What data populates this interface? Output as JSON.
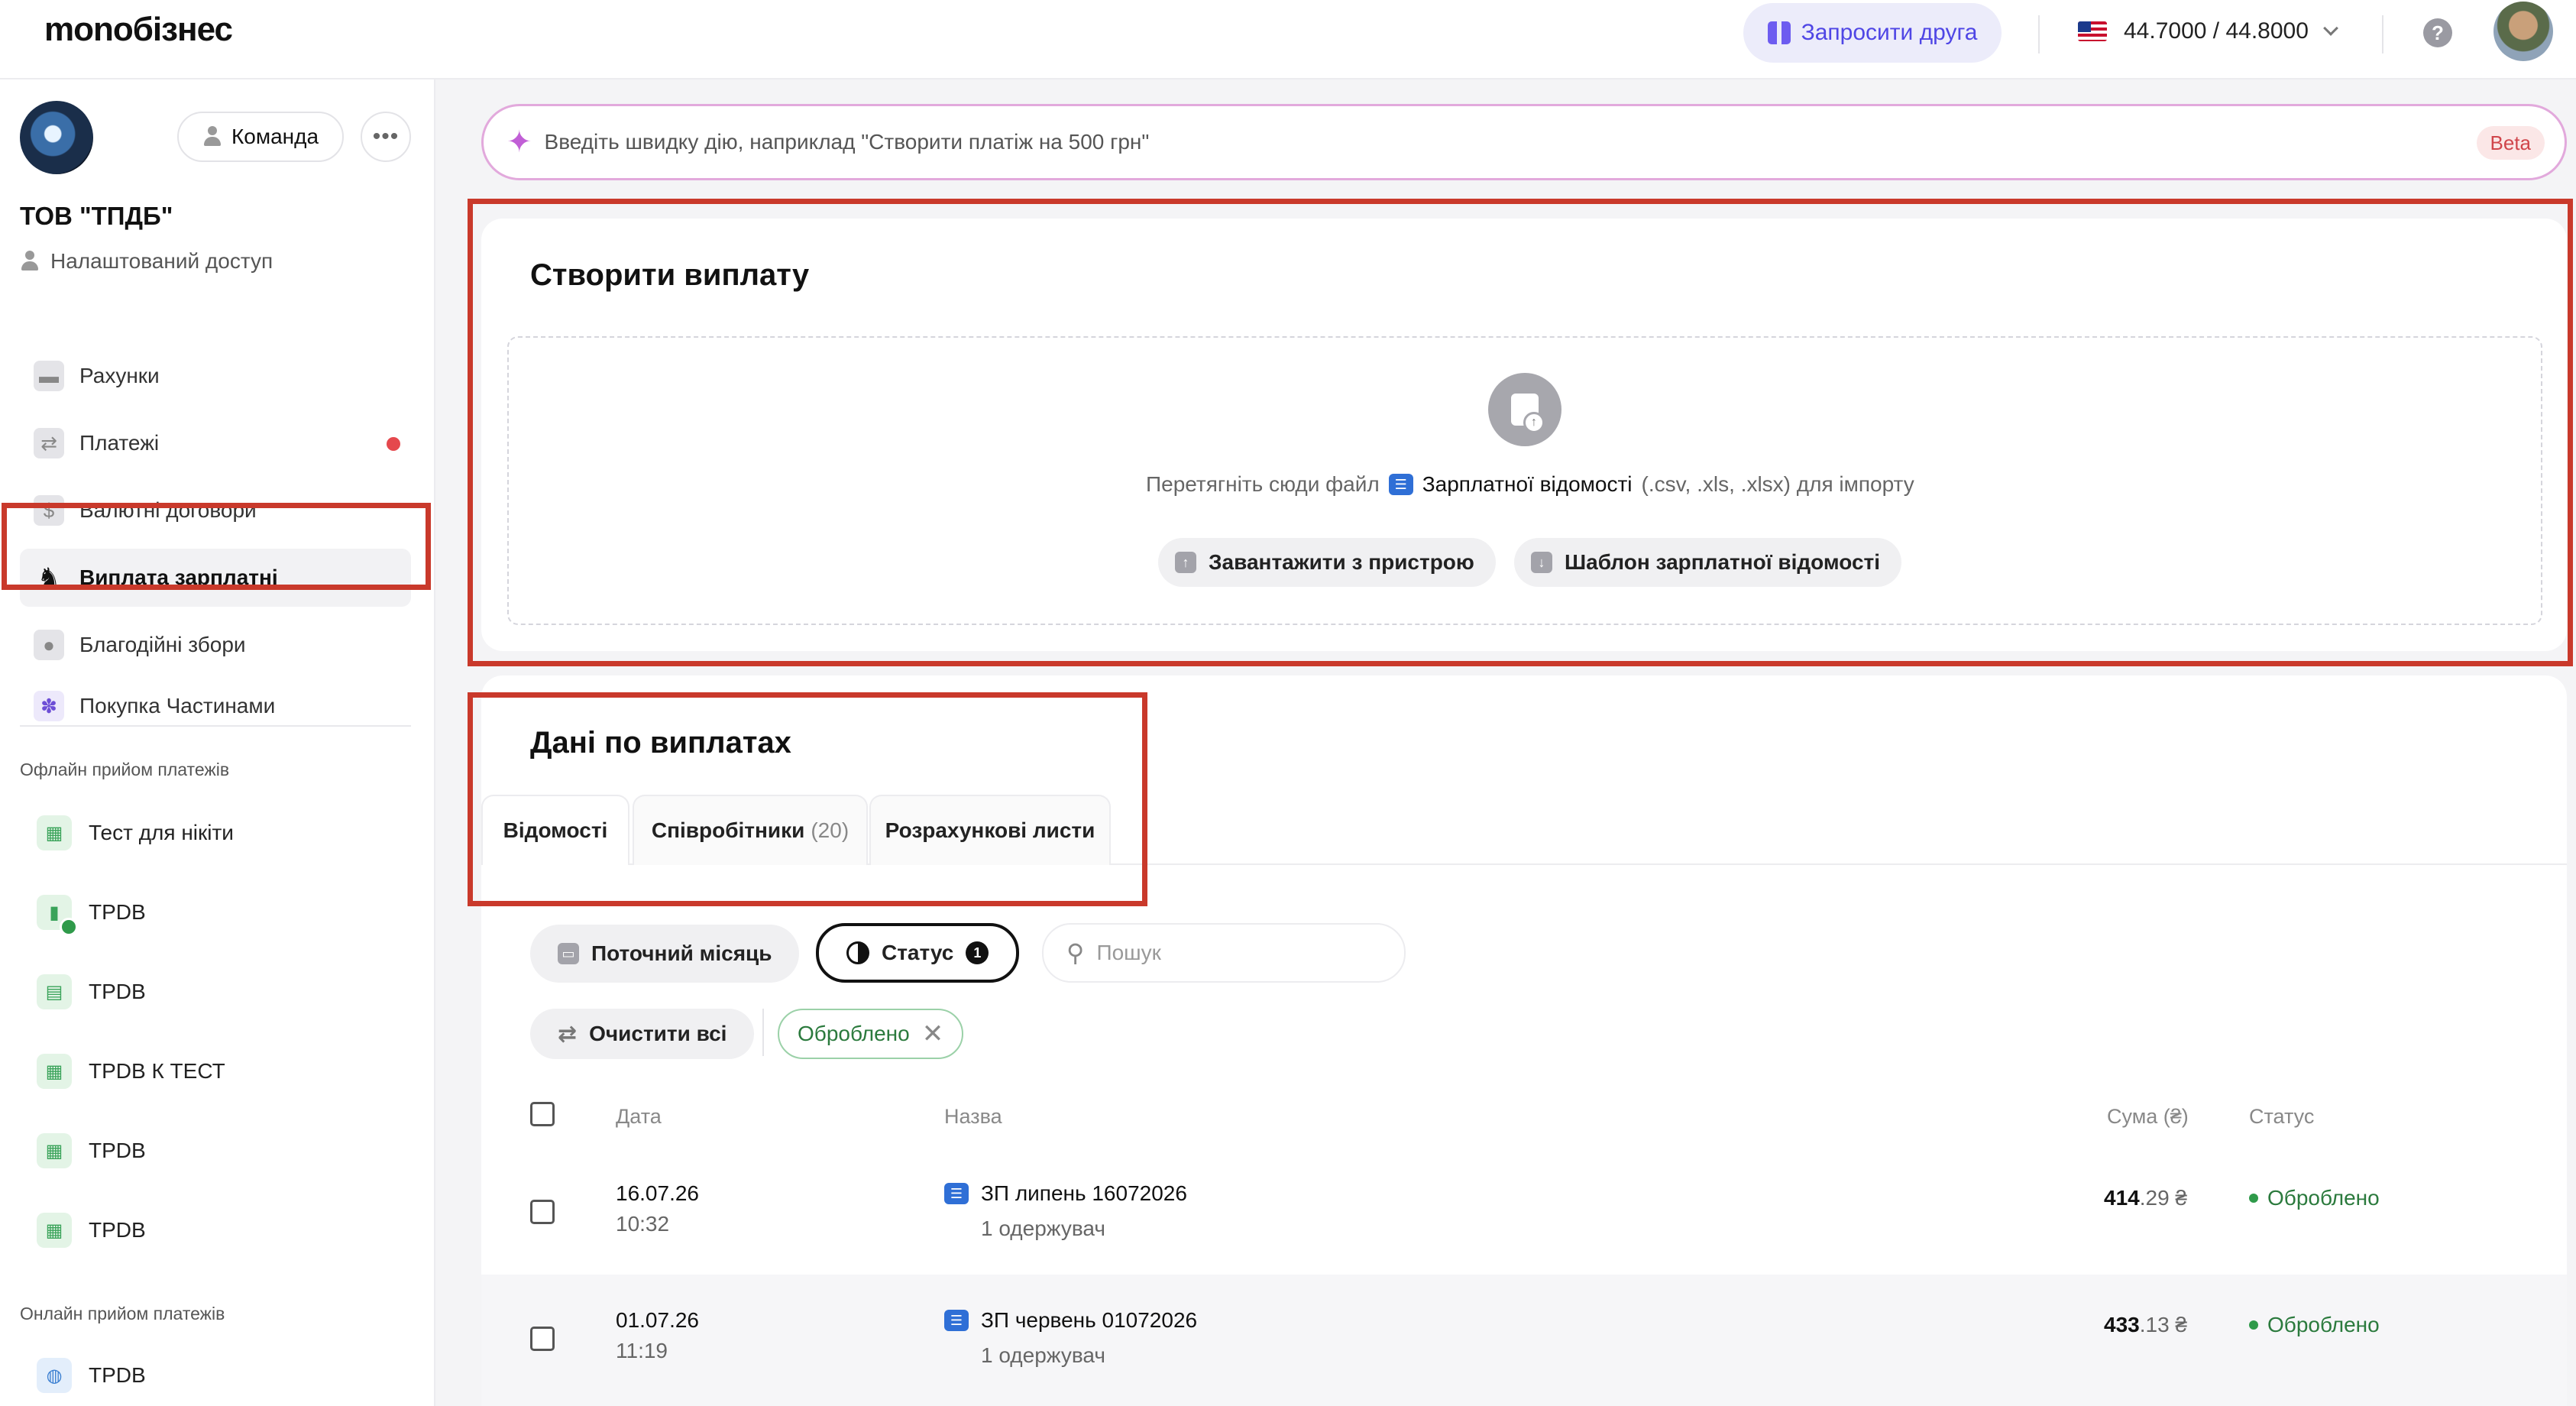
{
  "header": {
    "logo": "monoбізнес",
    "invite_label": "Запросити друга",
    "rate": "44.7000 / 44.8000"
  },
  "sidebar": {
    "team_label": "Команда",
    "org_name": "ТОВ \"ТПДБ\"",
    "access_label": "Налаштований доступ",
    "nav": [
      {
        "label": "Рахунки",
        "icon": "wallet-icon"
      },
      {
        "label": "Платежі",
        "icon": "transfer-icon"
      },
      {
        "label": "Валютні договори",
        "icon": "currency-doc-icon"
      },
      {
        "label": "Виплата зарплатні",
        "icon": "salary-icon"
      },
      {
        "label": "Благодійні збори",
        "icon": "charity-icon"
      },
      {
        "label": "Покупка Частинами",
        "icon": "paw-icon"
      }
    ],
    "offline_label": "Офлайн прийом платежів",
    "offline_items": [
      "Тест для нікіти",
      "TPDB",
      "TPDB",
      "TPDB К ТЕСТ",
      "TPDB",
      "TPDB"
    ],
    "online_label": "Онлайн прийом платежів",
    "online_items": [
      "TPDB"
    ]
  },
  "quick_action": {
    "placeholder": "Введіть швидку дію, наприклад \"Створити платіж на 500 грн\"",
    "badge": "Beta"
  },
  "create": {
    "title": "Створити виплату",
    "drop_prefix": "Перетягніть сюди файл",
    "drop_file": "Зарплатної відомості",
    "drop_suffix": "(.csv, .xls, .xlsx) для імпорту",
    "upload_label": "Завантажити з пристрою",
    "template_label": "Шаблон зарплатної відомості"
  },
  "payouts": {
    "title": "Дані по виплатах",
    "tabs": [
      {
        "label": "Відомості",
        "count": ""
      },
      {
        "label": "Співробітники",
        "count": "(20)"
      },
      {
        "label": "Розрахункові листи",
        "count": ""
      }
    ],
    "filters": {
      "month": "Поточний місяць",
      "status": "Статус",
      "status_count": "1",
      "search_placeholder": "Пошук",
      "clear": "Очистити всі",
      "chip": "Оброблено"
    },
    "columns": {
      "date": "Дата",
      "name": "Назва",
      "sum": "Сума (₴)",
      "status": "Статус"
    },
    "rows": [
      {
        "date": "16.07.26",
        "time": "10:32",
        "name": "ЗП липень 16072026",
        "recipients": "1 одержувач",
        "sum_int": "414",
        "sum_frac": ".29 ₴",
        "status": "Оброблено"
      },
      {
        "date": "01.07.26",
        "time": "11:19",
        "name": "ЗП червень 01072026",
        "recipients": "1 одержувач",
        "sum_int": "433",
        "sum_frac": ".13 ₴",
        "status": "Оброблено"
      }
    ]
  },
  "colors": {
    "accent": "#4f46e5",
    "success": "#2b7a3d",
    "highlight": "#c9392b"
  }
}
